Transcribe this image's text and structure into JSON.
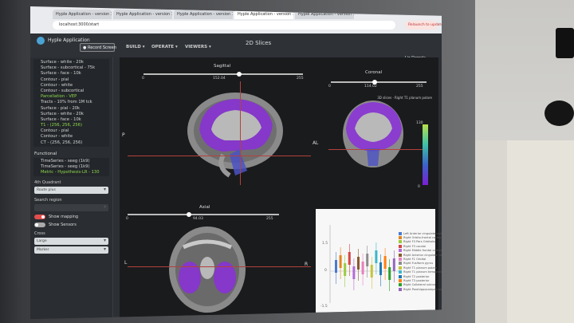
{
  "browser": {
    "tabs": [
      "Hyple Application - version 1",
      "Hyple Application - version 1",
      "Hyple Application - version 1",
      "Hyple Application - version 1",
      "Hyple Application - version 1"
    ],
    "address": "localhost:3000/start",
    "relaunch": "Relaunch to update"
  },
  "app": {
    "title": "Hyple Application",
    "record_button": "Record Screen",
    "view_title": "2D Slices",
    "menus": [
      "BUILD ▾",
      "OPERATE ▾",
      "VIEWERS ▾"
    ],
    "user": "Liz Dorrols"
  },
  "sidebar": {
    "layers": [
      {
        "label": "Surface - white - 20k",
        "green": false
      },
      {
        "label": "Surface - subcortical - 75k",
        "green": false
      },
      {
        "label": "Surface - face - 10k",
        "green": false
      },
      {
        "label": "Contour - pial",
        "green": false
      },
      {
        "label": "Contour - white",
        "green": false
      },
      {
        "label": "Contour - subcortical",
        "green": false
      },
      {
        "label": "Parcellation - VEP",
        "green": true
      },
      {
        "label": "Tracts - 10% from 1M tck",
        "green": false
      },
      {
        "label": "Surface - pial - 20k",
        "green": false
      },
      {
        "label": "Surface - white - 20k",
        "green": false
      },
      {
        "label": "Surface - face - 10k",
        "green": false
      },
      {
        "label": "T1 - (256, 256, 256)",
        "green": true
      },
      {
        "label": "Contour - pial",
        "green": false
      },
      {
        "label": "Contour - white",
        "green": false
      },
      {
        "label": "CT - (256, 256, 256)",
        "green": false
      }
    ],
    "functional_title": "Functional",
    "functional": [
      {
        "label": "TimeSeries - seeg (1k9)",
        "green": false
      },
      {
        "label": "TimeSeries - seeg (1k9)",
        "green": false
      },
      {
        "label": "Metric - Hypothesis-LR - 130",
        "green": true
      }
    ],
    "quadrant_label": "4th Quadrant",
    "quadrant_value": "Route plus",
    "search_label": "Search region",
    "show_mapping": "Show mapping",
    "show_sensors": "Show Sensors",
    "cross_label": "Cross",
    "cross_size": "Large",
    "cross_color": "Marker"
  },
  "viewer": {
    "sagittal": {
      "title": "Sagittal",
      "min": "0",
      "value": "152.04",
      "max": "255"
    },
    "coronal": {
      "title": "Coronal",
      "min": "0",
      "value": "114.02",
      "max": "255"
    },
    "axial": {
      "title": "Axial",
      "min": "0",
      "value": "94.03",
      "max": "255"
    },
    "projection_label": "3D slices · Right T1 planum polare",
    "orientation": {
      "P": "P",
      "A": "A",
      "L": "L",
      "R": "R"
    },
    "colorbar_top": "130",
    "colorbar_bottom": "0"
  },
  "legend": [
    {
      "label": "Left Anterior cingulate cortex",
      "color": "#4a7bd1"
    },
    {
      "label": "Right Orbito-frontal cortex",
      "color": "#e2861f"
    },
    {
      "label": "Right F3 Pars Orbitalis",
      "color": "#9acb3c"
    },
    {
      "label": "Right F3 caudal",
      "color": "#d64545"
    },
    {
      "label": "Right Middle frontal cortex",
      "color": "#b56bd6"
    },
    {
      "label": "Right Anterior cingulate cortex",
      "color": "#8b5a2b"
    },
    {
      "label": "Right F1 Orbital",
      "color": "#e87fc0"
    },
    {
      "label": "Right Fusiform gyrus",
      "color": "#8c8c8c"
    },
    {
      "label": "Right T1 planum polare",
      "color": "#c5c53a"
    },
    {
      "label": "Right T1 planum temporale",
      "color": "#3bb8c9"
    },
    {
      "label": "Right T2 posterior",
      "color": "#1f77b4"
    },
    {
      "label": "Right T3 posterior",
      "color": "#ff7f0e"
    },
    {
      "label": "Right Collateral sulcus",
      "color": "#2ca02c"
    },
    {
      "label": "Right Parahippocampal cortex",
      "color": "#9467bd"
    }
  ],
  "plot": {
    "y_top": "1.5",
    "y_zero": "0",
    "y_bottom": "-1.5"
  }
}
